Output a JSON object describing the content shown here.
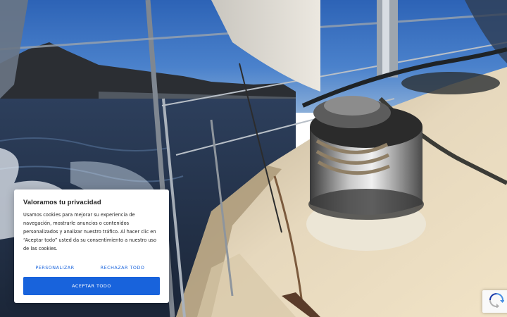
{
  "hero": {
    "image": "sailboat-deck-winch-photo"
  },
  "cookie_banner": {
    "title": "Valoramos tu privacidad",
    "body": "Usamos cookies para mejorar su experiencia de navegación, mostrarle anuncios o contenidos personalizados y analizar nuestro tráfico. Al hacer clic en “Aceptar todo” usted da su consentimiento a nuestro uso de las cookies.",
    "customize_label": "PERSONALIZAR",
    "reject_label": "RECHAZAR TODO",
    "accept_label": "ACEPTAR TODO",
    "accent_color": "#1863dc"
  },
  "recaptcha": {
    "icon": "recaptcha-icon"
  }
}
